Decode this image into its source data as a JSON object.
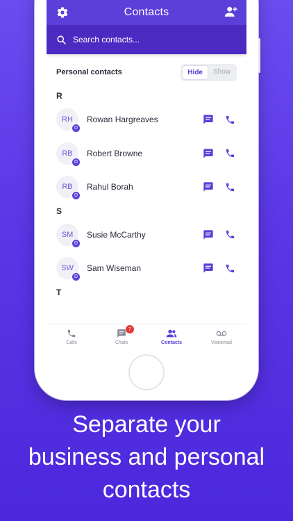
{
  "appbar": {
    "title": "Contacts"
  },
  "search": {
    "placeholder": "Search contacts..."
  },
  "personal": {
    "label": "Personal contacts",
    "hide": "Hide",
    "show": "Show"
  },
  "sections": [
    {
      "letter": "R",
      "contacts": [
        {
          "initials": "RH",
          "badge": "D",
          "name": "Rowan Hargreaves"
        },
        {
          "initials": "RB",
          "badge": "D",
          "name": "Robert Browne"
        },
        {
          "initials": "RB",
          "badge": "D",
          "name": "Rahul Borah"
        }
      ]
    },
    {
      "letter": "S",
      "contacts": [
        {
          "initials": "SM",
          "badge": "D",
          "name": "Susie McCarthy"
        },
        {
          "initials": "SW",
          "badge": "D",
          "name": "Sam Wiseman"
        }
      ]
    },
    {
      "letter": "T",
      "contacts": []
    }
  ],
  "tabs": [
    {
      "label": "Calls",
      "icon": "phone-icon"
    },
    {
      "label": "Chats",
      "icon": "chat-icon",
      "badge": "7"
    },
    {
      "label": "Contacts",
      "icon": "contacts-icon",
      "active": true
    },
    {
      "label": "Voicemail",
      "icon": "voicemail-icon"
    }
  ],
  "caption": {
    "line1": "Separate your",
    "line2": "business and personal",
    "line3": "contacts"
  },
  "colors": {
    "primary": "#5b3fd9",
    "background": "#5a36e6",
    "badge": "#e5383b"
  }
}
